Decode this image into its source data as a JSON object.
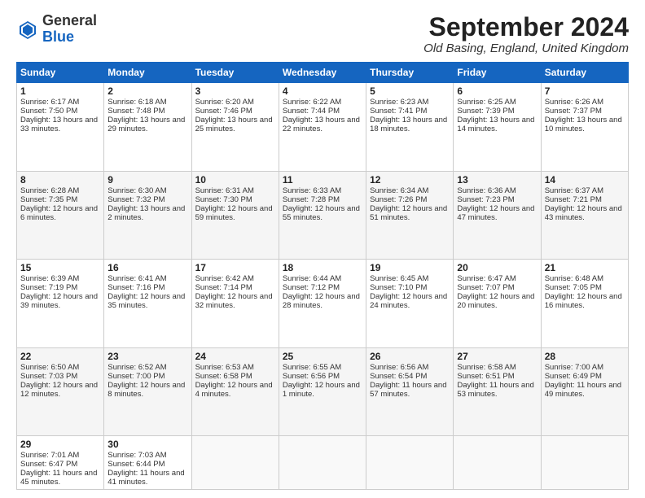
{
  "header": {
    "logo_general": "General",
    "logo_blue": "Blue",
    "title": "September 2024",
    "location": "Old Basing, England, United Kingdom"
  },
  "weekdays": [
    "Sunday",
    "Monday",
    "Tuesday",
    "Wednesday",
    "Thursday",
    "Friday",
    "Saturday"
  ],
  "weeks": [
    [
      {
        "day": "1",
        "sunrise": "6:17 AM",
        "sunset": "7:50 PM",
        "daylight": "13 hours and 33 minutes."
      },
      {
        "day": "2",
        "sunrise": "6:18 AM",
        "sunset": "7:48 PM",
        "daylight": "13 hours and 29 minutes."
      },
      {
        "day": "3",
        "sunrise": "6:20 AM",
        "sunset": "7:46 PM",
        "daylight": "13 hours and 25 minutes."
      },
      {
        "day": "4",
        "sunrise": "6:22 AM",
        "sunset": "7:44 PM",
        "daylight": "13 hours and 22 minutes."
      },
      {
        "day": "5",
        "sunrise": "6:23 AM",
        "sunset": "7:41 PM",
        "daylight": "13 hours and 18 minutes."
      },
      {
        "day": "6",
        "sunrise": "6:25 AM",
        "sunset": "7:39 PM",
        "daylight": "13 hours and 14 minutes."
      },
      {
        "day": "7",
        "sunrise": "6:26 AM",
        "sunset": "7:37 PM",
        "daylight": "13 hours and 10 minutes."
      }
    ],
    [
      {
        "day": "8",
        "sunrise": "6:28 AM",
        "sunset": "7:35 PM",
        "daylight": "12 hours and 6 minutes."
      },
      {
        "day": "9",
        "sunrise": "6:30 AM",
        "sunset": "7:32 PM",
        "daylight": "13 hours and 2 minutes."
      },
      {
        "day": "10",
        "sunrise": "6:31 AM",
        "sunset": "7:30 PM",
        "daylight": "12 hours and 59 minutes."
      },
      {
        "day": "11",
        "sunrise": "6:33 AM",
        "sunset": "7:28 PM",
        "daylight": "12 hours and 55 minutes."
      },
      {
        "day": "12",
        "sunrise": "6:34 AM",
        "sunset": "7:26 PM",
        "daylight": "12 hours and 51 minutes."
      },
      {
        "day": "13",
        "sunrise": "6:36 AM",
        "sunset": "7:23 PM",
        "daylight": "12 hours and 47 minutes."
      },
      {
        "day": "14",
        "sunrise": "6:37 AM",
        "sunset": "7:21 PM",
        "daylight": "12 hours and 43 minutes."
      }
    ],
    [
      {
        "day": "15",
        "sunrise": "6:39 AM",
        "sunset": "7:19 PM",
        "daylight": "12 hours and 39 minutes."
      },
      {
        "day": "16",
        "sunrise": "6:41 AM",
        "sunset": "7:16 PM",
        "daylight": "12 hours and 35 minutes."
      },
      {
        "day": "17",
        "sunrise": "6:42 AM",
        "sunset": "7:14 PM",
        "daylight": "12 hours and 32 minutes."
      },
      {
        "day": "18",
        "sunrise": "6:44 AM",
        "sunset": "7:12 PM",
        "daylight": "12 hours and 28 minutes."
      },
      {
        "day": "19",
        "sunrise": "6:45 AM",
        "sunset": "7:10 PM",
        "daylight": "12 hours and 24 minutes."
      },
      {
        "day": "20",
        "sunrise": "6:47 AM",
        "sunset": "7:07 PM",
        "daylight": "12 hours and 20 minutes."
      },
      {
        "day": "21",
        "sunrise": "6:48 AM",
        "sunset": "7:05 PM",
        "daylight": "12 hours and 16 minutes."
      }
    ],
    [
      {
        "day": "22",
        "sunrise": "6:50 AM",
        "sunset": "7:03 PM",
        "daylight": "12 hours and 12 minutes."
      },
      {
        "day": "23",
        "sunrise": "6:52 AM",
        "sunset": "7:00 PM",
        "daylight": "12 hours and 8 minutes."
      },
      {
        "day": "24",
        "sunrise": "6:53 AM",
        "sunset": "6:58 PM",
        "daylight": "12 hours and 4 minutes."
      },
      {
        "day": "25",
        "sunrise": "6:55 AM",
        "sunset": "6:56 PM",
        "daylight": "12 hours and 1 minute."
      },
      {
        "day": "26",
        "sunrise": "6:56 AM",
        "sunset": "6:54 PM",
        "daylight": "11 hours and 57 minutes."
      },
      {
        "day": "27",
        "sunrise": "6:58 AM",
        "sunset": "6:51 PM",
        "daylight": "11 hours and 53 minutes."
      },
      {
        "day": "28",
        "sunrise": "7:00 AM",
        "sunset": "6:49 PM",
        "daylight": "11 hours and 49 minutes."
      }
    ],
    [
      {
        "day": "29",
        "sunrise": "7:01 AM",
        "sunset": "6:47 PM",
        "daylight": "11 hours and 45 minutes."
      },
      {
        "day": "30",
        "sunrise": "7:03 AM",
        "sunset": "6:44 PM",
        "daylight": "11 hours and 41 minutes."
      },
      null,
      null,
      null,
      null,
      null
    ]
  ]
}
